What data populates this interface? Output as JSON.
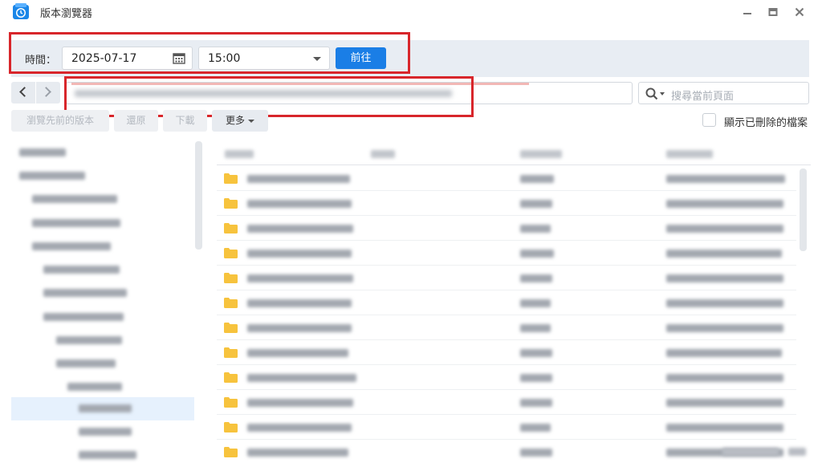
{
  "window": {
    "title": "版本瀏覽器",
    "minimize_icon": "minimize-icon",
    "maximize_icon": "maximize-icon",
    "close_icon": "close-icon",
    "app_icon": "clock-app-icon"
  },
  "time_filter": {
    "label": "時間：",
    "date_value": "2025-07-17",
    "time_value": "15:00",
    "go_label": "前往"
  },
  "search": {
    "placeholder": "搜尋當前頁面"
  },
  "actions": {
    "browse_previous": "瀏覽先前的版本",
    "restore": "還原",
    "download": "下載",
    "more": "更多"
  },
  "show_deleted": {
    "label": "顯示已刪除的檔案",
    "checked": false
  },
  "colors": {
    "accent": "#1a7ee6",
    "highlight_box": "#d8262b",
    "folder": "#f7c33d",
    "selected_row": "#e6f1fd"
  }
}
